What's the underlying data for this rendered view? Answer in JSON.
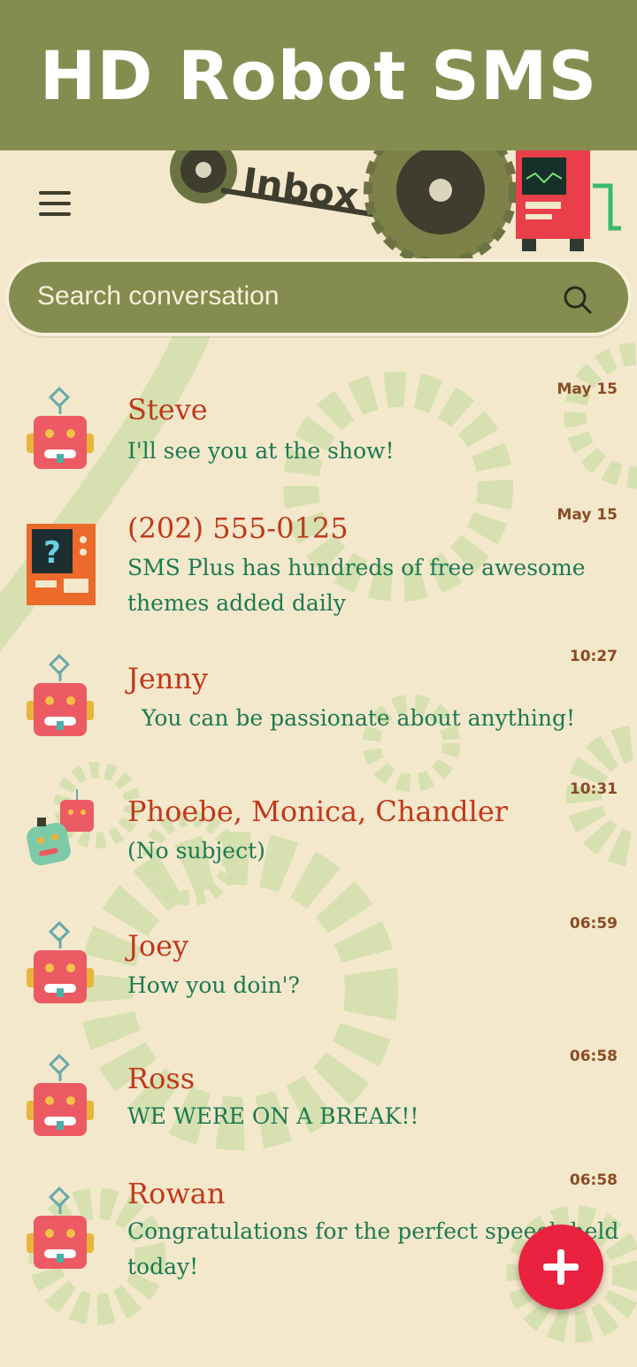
{
  "banner": {
    "title": "HD Robot SMS"
  },
  "header": {
    "title": "Inbox"
  },
  "search": {
    "placeholder": "Search conversation"
  },
  "conversations": [
    {
      "name": "Steve",
      "snippet": "I'll see you at the show!",
      "time": "May 15",
      "avatar": "robot-red-icon"
    },
    {
      "name": "(202) 555-0125",
      "snippet": "SMS Plus has hundreds of free awesome themes added daily",
      "time": "May 15",
      "avatar": "robot-screen-icon"
    },
    {
      "name": "Jenny",
      "snippet": "You can be passionate about anything!",
      "time": "10:27",
      "avatar": "robot-red-icon"
    },
    {
      "name": "Phoebe, Monica, Chandler",
      "snippet": "(No subject)",
      "time": "10:31",
      "avatar": "robot-group-icon"
    },
    {
      "name": "Joey",
      "snippet": "How you doin'?",
      "time": "06:59",
      "avatar": "robot-red-icon"
    },
    {
      "name": "Ross",
      "snippet": "WE WERE ON A BREAK!!",
      "time": "06:58",
      "avatar": "robot-red-icon"
    },
    {
      "name": "Rowan",
      "snippet": "Congratulations for the perfect speech held today!",
      "time": "06:58",
      "avatar": "robot-red-icon"
    }
  ],
  "fab": {
    "icon": "plus-icon"
  }
}
